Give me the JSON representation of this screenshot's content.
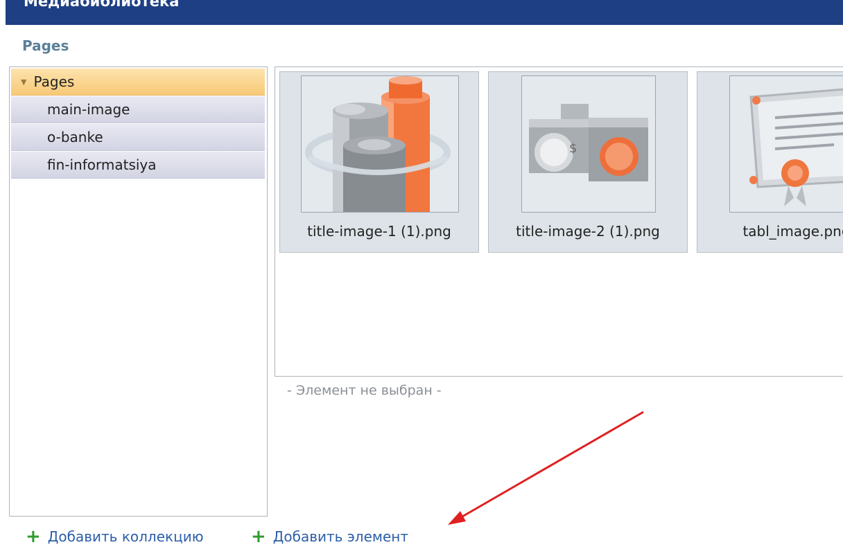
{
  "header": {
    "title": "Медиабиблиотека"
  },
  "collection": {
    "name": "Pages"
  },
  "tree": {
    "root": "Pages",
    "items": [
      {
        "label": "main-image"
      },
      {
        "label": "o-banke"
      },
      {
        "label": "fin-informatsiya"
      }
    ]
  },
  "files": [
    {
      "name": "title-image-1 (1).png"
    },
    {
      "name": "title-image-2 (1).png"
    },
    {
      "name": "tabl_image.png"
    }
  ],
  "status": "- Элемент не выбран -",
  "actions": {
    "add_collection": "Добавить коллекцию",
    "add_element": "Добавить элемент"
  },
  "colors": {
    "header_bg": "#1e3f84",
    "tree_selected": "#f7c977",
    "link": "#2c5ea8",
    "plus": "#2f9a2f",
    "annotation_arrow": "#e02020"
  }
}
